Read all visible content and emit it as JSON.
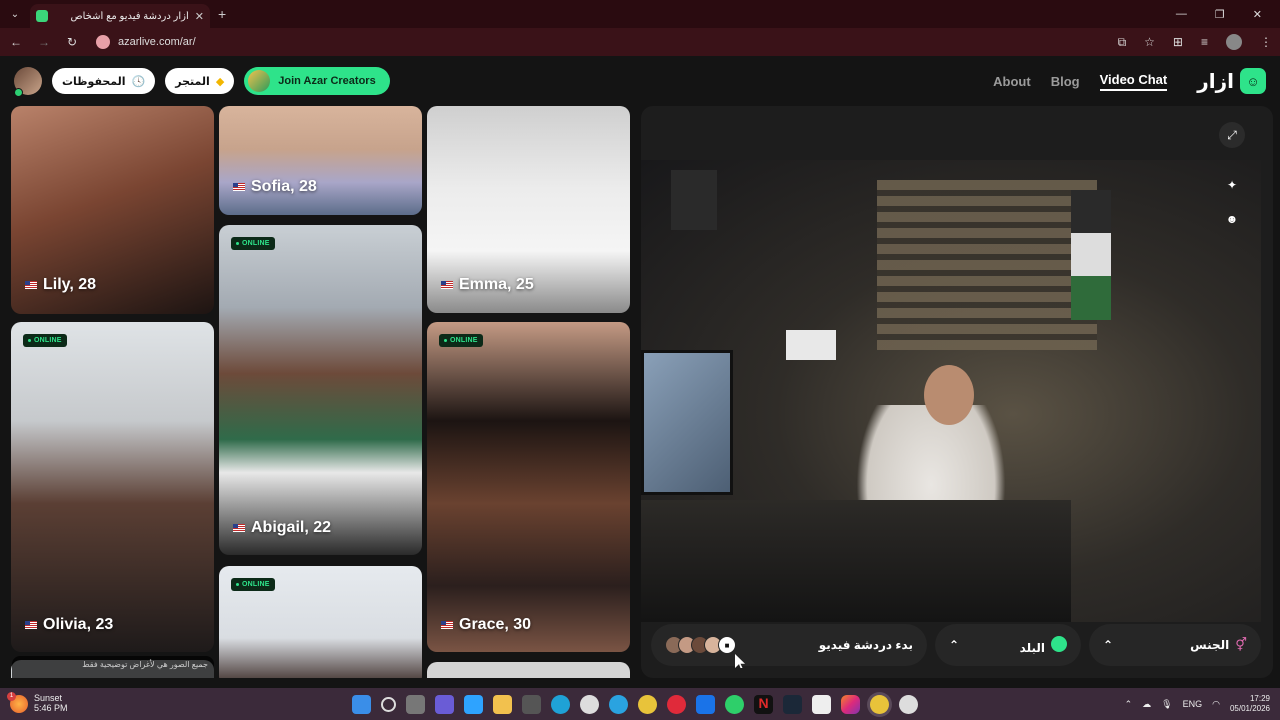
{
  "browser": {
    "tab_title": "أزار دردشة فيديو مع أشخاص",
    "url": "azarlive.com/ar/"
  },
  "header": {
    "saved_label": "المحفوظات",
    "store_label": "المتجر",
    "creators_label": "Join Azar Creators",
    "nav": [
      "About",
      "Blog",
      "Video Chat"
    ],
    "logo_text": "ازار"
  },
  "profiles": [
    {
      "name": "Lily, 28",
      "online": false
    },
    {
      "name": "Sofia, 28",
      "online": false
    },
    {
      "name": "Emma, 25",
      "online": false
    },
    {
      "name": "Olivia, 23",
      "online": true
    },
    {
      "name": "Abigail, 22",
      "online": true
    },
    {
      "name": "Grace, 30",
      "online": true
    },
    {
      "name": "",
      "online": true
    }
  ],
  "online_label": "ONLINE",
  "scroll_hint": "جميع الصور هي لأغراض توضيحية فقط",
  "controls": {
    "start_label": "بدء دردشة فيديو",
    "country_label": "البلد",
    "gender_label": "الجنس"
  },
  "taskbar": {
    "weather_title": "Sunset",
    "weather_time": "5:46 PM",
    "lang": "ENG",
    "time": "17:29",
    "date": "05/01/2026"
  },
  "colors": {
    "accent": "#2ee38a",
    "background": "#141414",
    "panel": "#1d1d1d"
  }
}
